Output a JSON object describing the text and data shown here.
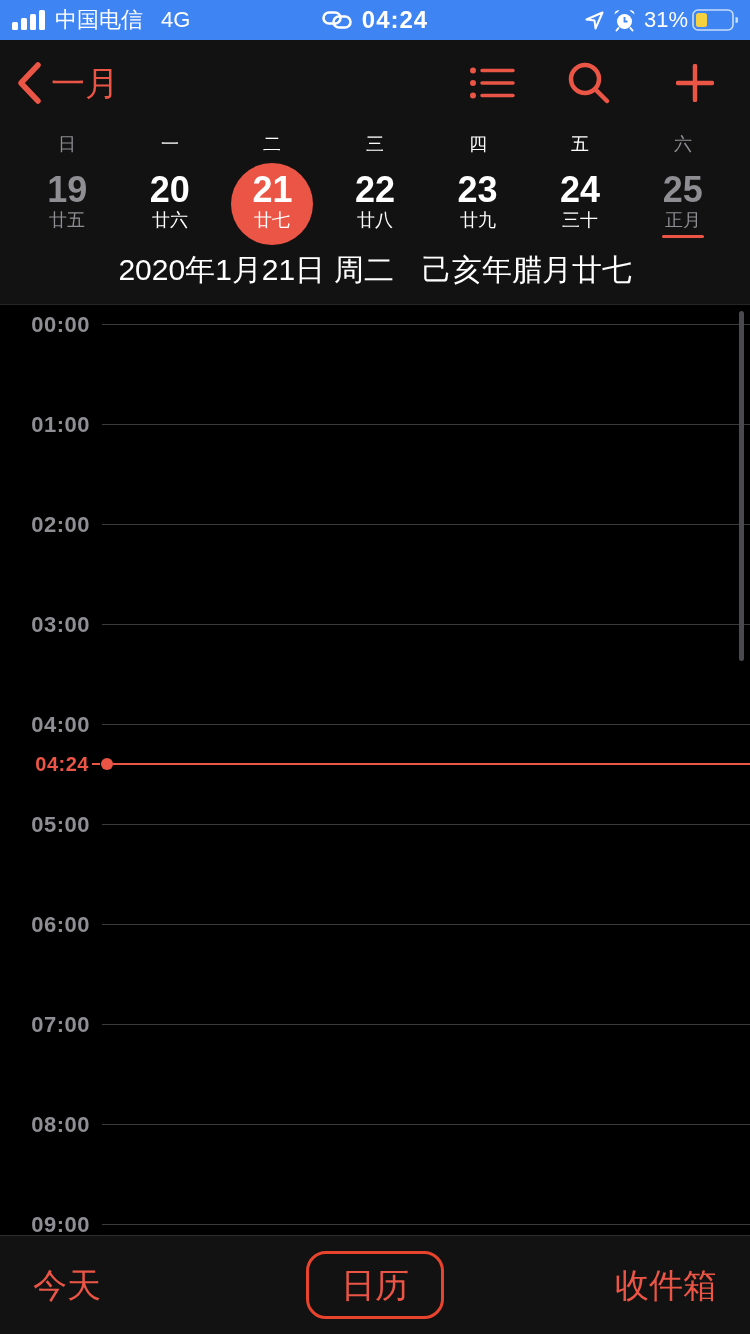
{
  "status_bar": {
    "carrier": "中国电信",
    "network": "4G",
    "time": "04:24",
    "battery": "31%"
  },
  "nav": {
    "back_label": "一月"
  },
  "weekdays": [
    {
      "label": "日",
      "weekend": true
    },
    {
      "label": "一",
      "weekend": false
    },
    {
      "label": "二",
      "weekend": false
    },
    {
      "label": "三",
      "weekend": false
    },
    {
      "label": "四",
      "weekend": false
    },
    {
      "label": "五",
      "weekend": false
    },
    {
      "label": "六",
      "weekend": true
    }
  ],
  "days": [
    {
      "number": "19",
      "lunar": "廿五",
      "selected": false,
      "marked": false
    },
    {
      "number": "20",
      "lunar": "廿六",
      "selected": false,
      "marked": false
    },
    {
      "number": "21",
      "lunar": "廿七",
      "selected": true,
      "marked": false
    },
    {
      "number": "22",
      "lunar": "廿八",
      "selected": false,
      "marked": false
    },
    {
      "number": "23",
      "lunar": "廿九",
      "selected": false,
      "marked": false
    },
    {
      "number": "24",
      "lunar": "三十",
      "selected": false,
      "marked": false
    },
    {
      "number": "25",
      "lunar": "正月",
      "selected": false,
      "marked": true
    }
  ],
  "date_title": {
    "gregorian": "2020年1月21日 周二",
    "lunar": "己亥年腊月廿七"
  },
  "timeline": [
    {
      "kind": "hour",
      "label": "00:00"
    },
    {
      "kind": "hour",
      "label": "01:00"
    },
    {
      "kind": "hour",
      "label": "02:00"
    },
    {
      "kind": "hour",
      "label": "03:00"
    },
    {
      "kind": "hour",
      "label": "04:00"
    },
    {
      "kind": "now",
      "label": "04:24"
    },
    {
      "kind": "hour",
      "label": "05:00"
    },
    {
      "kind": "hour",
      "label": "06:00"
    },
    {
      "kind": "hour",
      "label": "07:00"
    },
    {
      "kind": "hour",
      "label": "08:00"
    },
    {
      "kind": "hour",
      "label": "09:00"
    }
  ],
  "bottom_bar": [
    {
      "label": "今天",
      "highlighted": false
    },
    {
      "label": "日历",
      "highlighted": true
    },
    {
      "label": "收件箱",
      "highlighted": false
    }
  ]
}
